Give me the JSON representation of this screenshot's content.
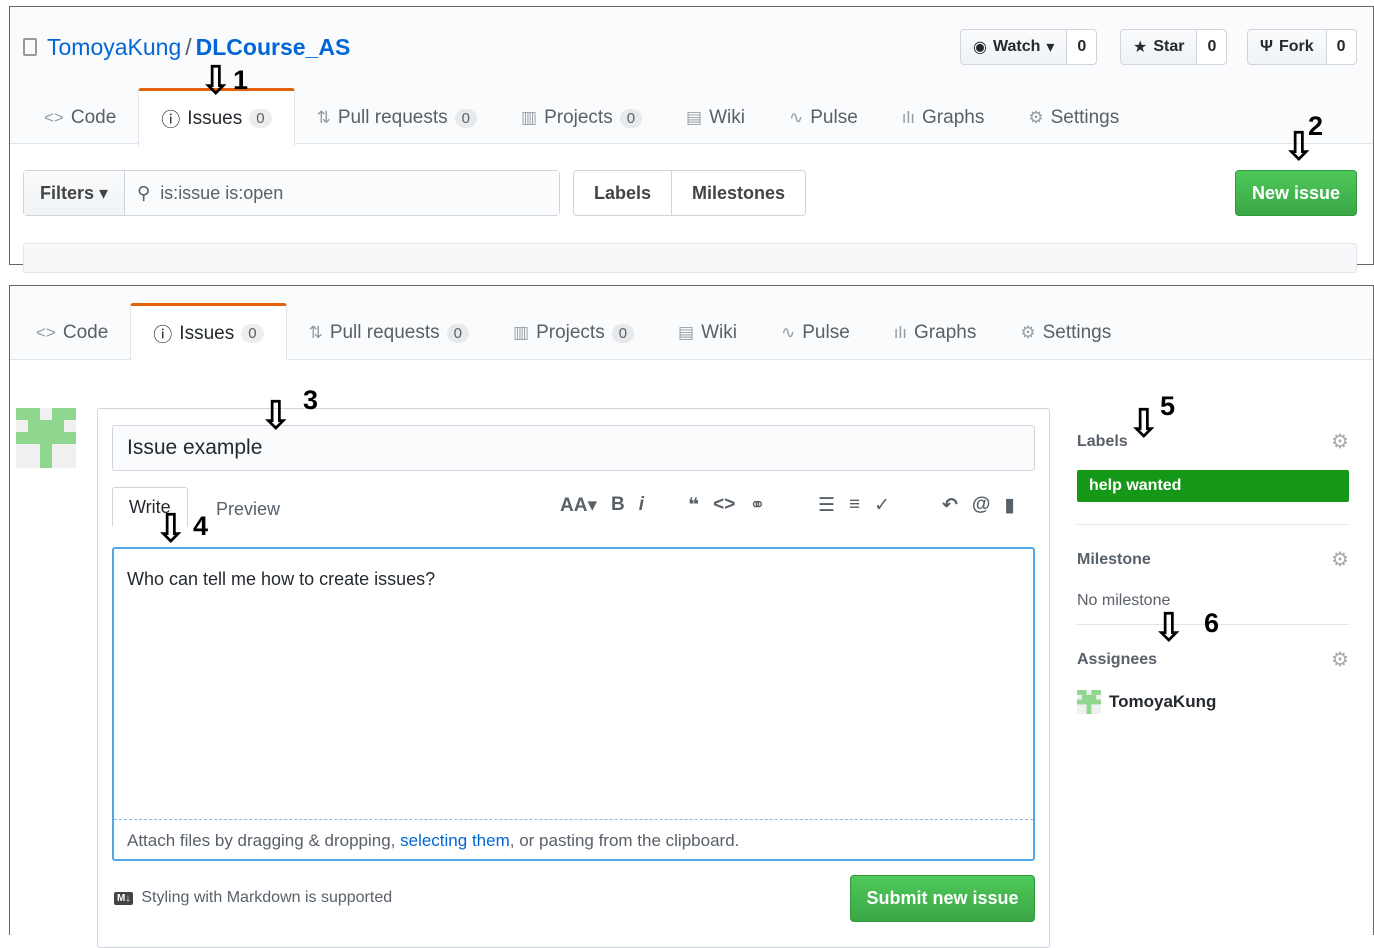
{
  "top": {
    "owner": "TomoyaKung",
    "repo": "DLCourse_AS",
    "watch": {
      "label": "Watch",
      "count": "0"
    },
    "star": {
      "label": "Star",
      "count": "0"
    },
    "fork": {
      "label": "Fork",
      "count": "0"
    },
    "filters_label": "Filters",
    "search_value": "is:issue is:open",
    "labels_btn": "Labels",
    "milestones_btn": "Milestones",
    "new_issue": "New issue"
  },
  "tabs": [
    {
      "label": "Code",
      "icon": "code-icon"
    },
    {
      "label": "Issues",
      "count": "0",
      "icon": "issue-icon"
    },
    {
      "label": "Pull requests",
      "count": "0",
      "icon": "pull-request-icon"
    },
    {
      "label": "Projects",
      "count": "0",
      "icon": "project-icon"
    },
    {
      "label": "Wiki",
      "icon": "wiki-icon"
    },
    {
      "label": "Pulse",
      "icon": "pulse-icon"
    },
    {
      "label": "Graphs",
      "icon": "graph-icon"
    },
    {
      "label": "Settings",
      "icon": "gear-icon"
    }
  ],
  "form": {
    "title_value": "Issue example",
    "write_tab": "Write",
    "preview_tab": "Preview",
    "body_value": "Who can tell me how to create issues?",
    "attach_pre": "Attach files by dragging & dropping, ",
    "attach_link": "selecting them",
    "attach_post": ", or pasting from the clipboard.",
    "markdown_note": "Styling with Markdown is supported",
    "submit": "Submit new issue"
  },
  "sidebar": {
    "labels_heading": "Labels",
    "label_value": "help wanted",
    "label_color": "#159818",
    "milestone_heading": "Milestone",
    "milestone_value": "No milestone",
    "assignees_heading": "Assignees",
    "assignee": "TomoyaKung"
  },
  "annotations": [
    "1",
    "2",
    "3",
    "4",
    "5",
    "6"
  ],
  "colors": {
    "accent_orange": "#e36209",
    "link_blue": "#0366d6",
    "green_button": "#3aa745"
  }
}
